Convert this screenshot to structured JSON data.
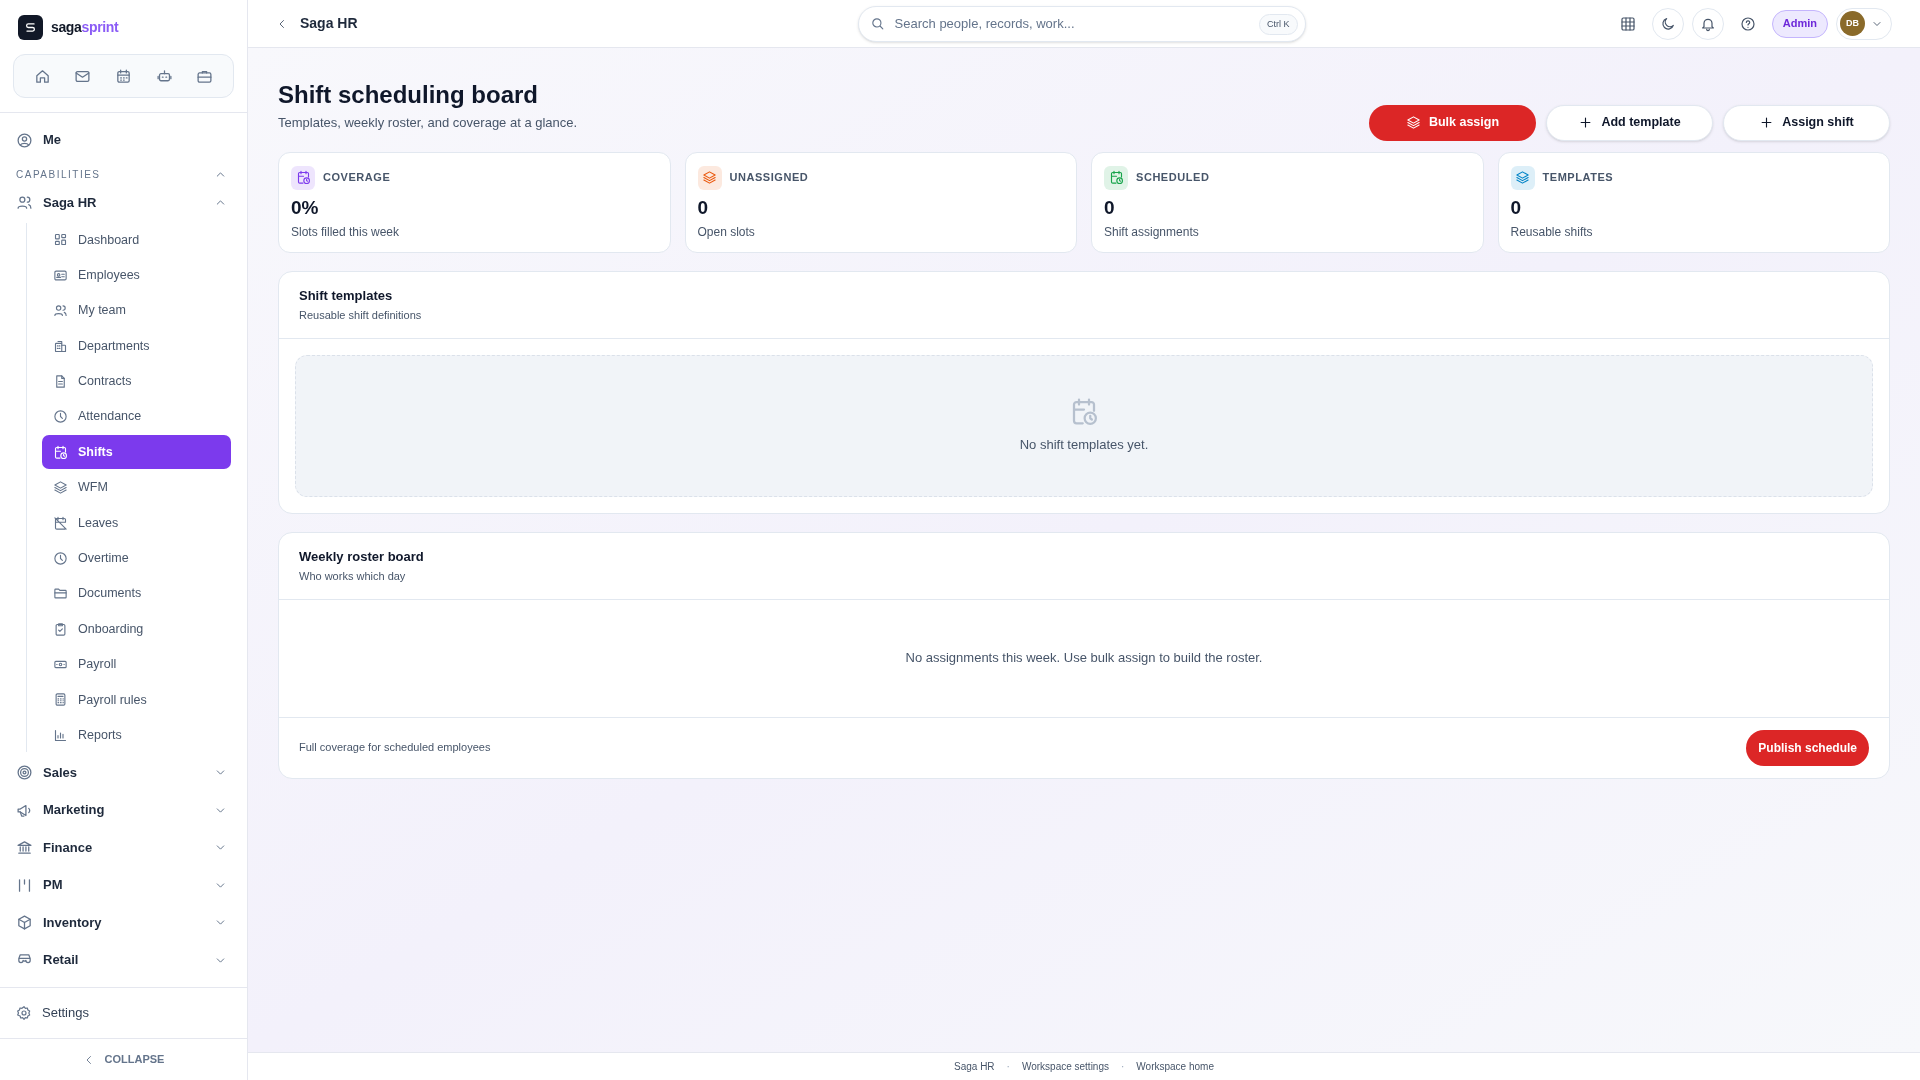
{
  "brand": {
    "name_part_1": "saga",
    "name_part_2": "sprint"
  },
  "sidebar": {
    "me": "Me",
    "section": {
      "label": "CAPABILITIES",
      "expanded": true
    },
    "groups": [
      {
        "label": "Saga HR",
        "expanded": true,
        "children": [
          {
            "label": "Dashboard",
            "selected": false
          },
          {
            "label": "Employees",
            "selected": false
          },
          {
            "label": "My team",
            "selected": false
          },
          {
            "label": "Departments",
            "selected": false
          },
          {
            "label": "Contracts",
            "selected": false
          },
          {
            "label": "Attendance",
            "selected": false
          },
          {
            "label": "Shifts",
            "selected": true
          },
          {
            "label": "WFM",
            "selected": false
          },
          {
            "label": "Leaves",
            "selected": false
          },
          {
            "label": "Overtime",
            "selected": false
          },
          {
            "label": "Documents",
            "selected": false
          },
          {
            "label": "Onboarding",
            "selected": false
          },
          {
            "label": "Payroll",
            "selected": false
          },
          {
            "label": "Payroll rules",
            "selected": false
          },
          {
            "label": "Reports",
            "selected": false
          }
        ]
      },
      {
        "label": "Sales",
        "expanded": false
      },
      {
        "label": "Marketing",
        "expanded": false
      },
      {
        "label": "Finance",
        "expanded": false
      },
      {
        "label": "PM",
        "expanded": false
      },
      {
        "label": "Inventory",
        "expanded": false
      },
      {
        "label": "Retail",
        "expanded": false
      }
    ],
    "settings": "Settings",
    "collapse": "COLLAPSE"
  },
  "topbar": {
    "breadcrumb": "Saga HR",
    "search": {
      "placeholder": "Search people, records, work...",
      "shortcut": "Ctrl K"
    },
    "role": "Admin",
    "avatar": "DB"
  },
  "page": {
    "title": "Shift scheduling board",
    "subtitle": "Templates, weekly roster, and coverage at a glance.",
    "actions": [
      {
        "label": "Bulk assign",
        "kind": "primary"
      },
      {
        "label": "Add template",
        "kind": "secondary"
      },
      {
        "label": "Assign shift",
        "kind": "secondary"
      }
    ]
  },
  "stats": [
    {
      "label": "COVERAGE",
      "value": "0%",
      "caption": "Slots filled this week",
      "color": "#7c3aed"
    },
    {
      "label": "UNASSIGNED",
      "value": "0",
      "caption": "Open slots",
      "color": "#ea580c"
    },
    {
      "label": "SCHEDULED",
      "value": "0",
      "caption": "Shift assignments",
      "color": "#16a34a"
    },
    {
      "label": "TEMPLATES",
      "value": "0",
      "caption": "Reusable shifts",
      "color": "#0284c7"
    }
  ],
  "templates": {
    "title": "Shift templates",
    "subtitle": "Reusable shift definitions",
    "empty": "No shift templates yet."
  },
  "roster": {
    "title": "Weekly roster board",
    "subtitle": "Who works which day",
    "empty": "No assignments this week. Use bulk assign to build the roster.",
    "footer_note": "Full coverage for scheduled employees",
    "publish": "Publish schedule"
  },
  "footer": {
    "links": [
      "Saga HR",
      "Workspace settings",
      "Workspace home"
    ],
    "separator": "·"
  }
}
